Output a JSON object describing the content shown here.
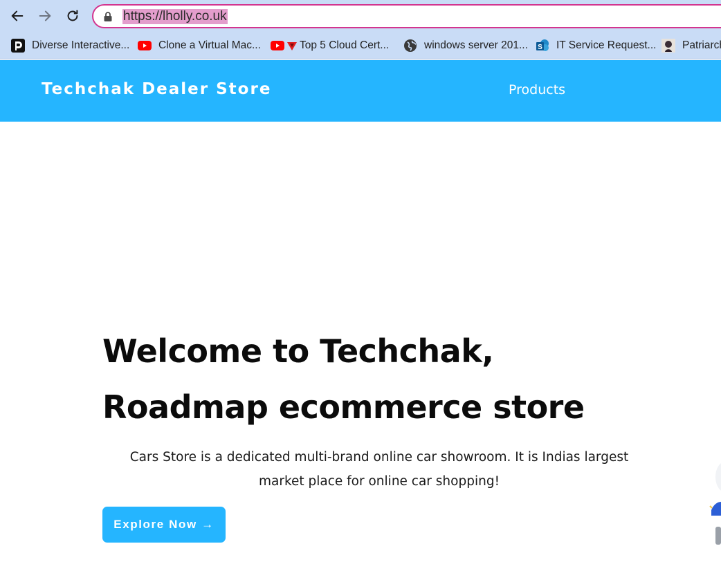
{
  "browser": {
    "url": "https://lholly.co.uk",
    "bookmarks": [
      {
        "label": "Diverse Interactive...",
        "icon": "diverse-interactive-icon"
      },
      {
        "label": "Clone a Virtual Mac...",
        "icon": "youtube-icon"
      },
      {
        "label": "Top 5 Cloud Cert...",
        "icon": "youtube-icon"
      },
      {
        "label": "windows server 201...",
        "icon": "globe-icon"
      },
      {
        "label": "IT Service Request...",
        "icon": "sharepoint-icon"
      },
      {
        "label": "Patriarch",
        "icon": "avatar-icon"
      }
    ]
  },
  "header": {
    "brand": "Techchak Dealer Store",
    "nav": [
      "Products"
    ]
  },
  "hero": {
    "title_line1": "Welcome to Techchak,",
    "title_line2": "Roadmap ecommerce store",
    "description": "Cars Store is a dedicated multi-brand online car showroom. It is Indias largest market place for online car shopping!",
    "cta_label": "Explore Now →"
  },
  "colors": {
    "accent": "#25b5ff",
    "browser_chrome": "#c9dcf6",
    "omnibox_border": "#d3348f",
    "url_highlight": "#e39dcc"
  }
}
